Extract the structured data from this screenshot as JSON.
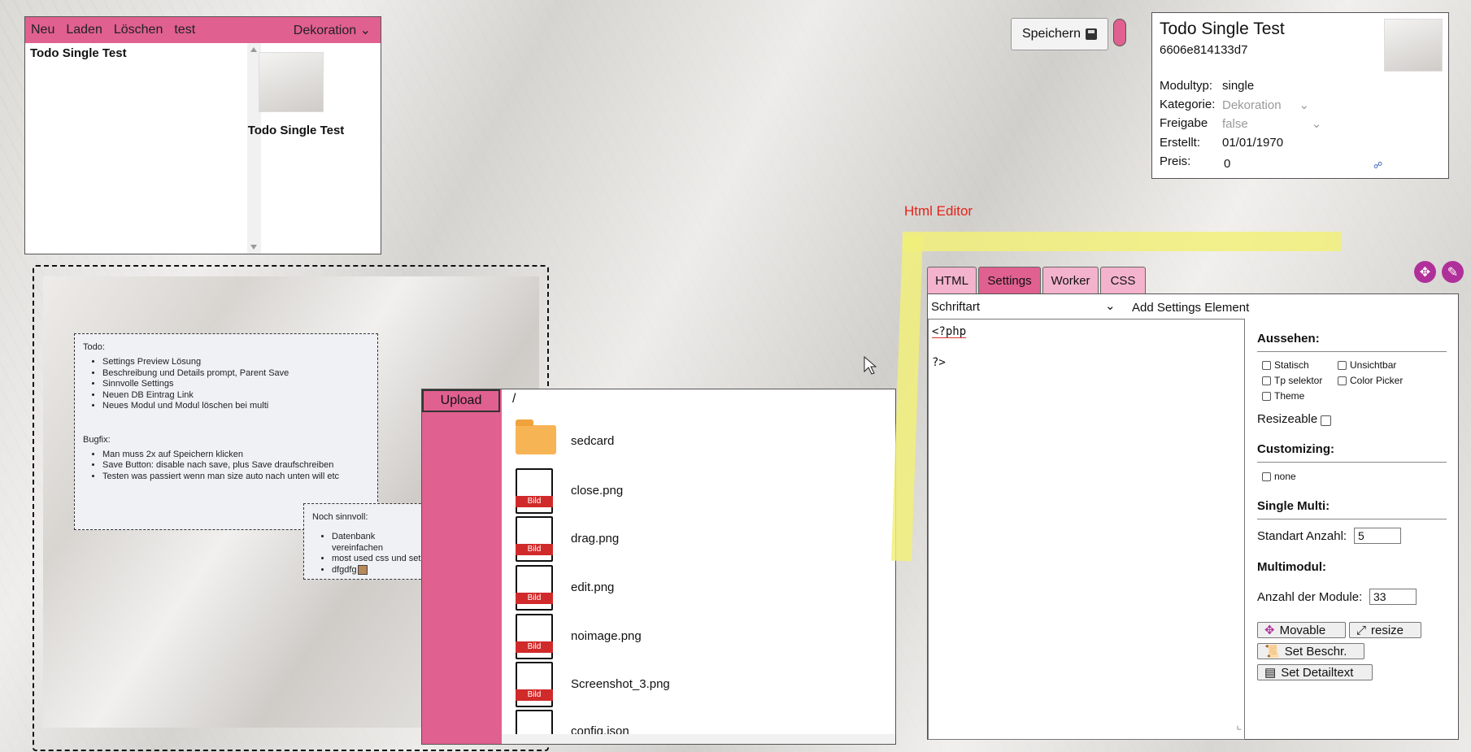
{
  "list_panel": {
    "menu": [
      "Neu",
      "Laden",
      "Löschen",
      "test"
    ],
    "category_dropdown": "Dekoration",
    "items": [
      "Todo Single Test"
    ],
    "thumb_label": "Todo Single Test"
  },
  "toolbar": {
    "save_label": "Speichern"
  },
  "details": {
    "title": "Todo Single Test",
    "id": "6606e814133d7",
    "rows": [
      {
        "label": "Modultyp:",
        "value": "single"
      },
      {
        "label": "Kategorie:",
        "value": "Dekoration"
      },
      {
        "label": "Freigabe",
        "value": "false"
      },
      {
        "label": "Erstellt:",
        "value": "01/01/1970"
      },
      {
        "label": "Preis:",
        "value": "0"
      }
    ]
  },
  "preview": {
    "note1": {
      "todo_title": "Todo:",
      "todo_items": [
        "Settings Preview Lösung",
        "Beschreibung und Details prompt, Parent Save",
        "Sinnvolle Settings",
        "Neuen DB Eintrag Link",
        "Neues Modul und Modul löschen bei multi"
      ],
      "bugfix_title": "Bugfix:",
      "bugfix_items": [
        "Man muss 2x auf Speichern klicken",
        "Save Button: disable nach save, plus Save draufschreiben",
        "Testen was passiert wenn man size auto nach unten will etc"
      ]
    },
    "note2": {
      "title": "Noch sinnvoll:",
      "items": [
        "Datenbank vereinfachen",
        "most used css und set",
        "dfgdfg"
      ]
    }
  },
  "editor": {
    "label": "Html Editor",
    "tabs": [
      "HTML",
      "Settings",
      "Worker",
      "CSS"
    ],
    "active_tab": "Settings",
    "font_select": "Schriftart",
    "add_settings": "Add Settings Element",
    "code_lines": [
      "<?php",
      "",
      "?>"
    ]
  },
  "settings": {
    "appearance_title": "Aussehen:",
    "appearance_options": [
      "Statisch",
      "Unsichtbar",
      "Tp selektor",
      "Color Picker",
      "Theme"
    ],
    "resizeable_label": "Resizeable",
    "customizing_title": "Customizing:",
    "customizing_options": [
      "none"
    ],
    "single_multi_title": "Single Multi:",
    "standart_label": "Standart Anzahl:",
    "standart_value": "5",
    "multimodul_title": "Multimodul:",
    "module_count_label": "Anzahl der Module:",
    "module_count_value": "33",
    "buttons": [
      "Movable",
      "resize",
      "Set Beschr.",
      "Set Detailtext"
    ]
  },
  "file_manager": {
    "upload_label": "Upload",
    "path": "/",
    "doc_badge": "Bild",
    "files": [
      {
        "name": "sedcard",
        "type": "folder"
      },
      {
        "name": "close.png",
        "type": "image"
      },
      {
        "name": "drag.png",
        "type": "image"
      },
      {
        "name": "edit.png",
        "type": "image"
      },
      {
        "name": "noimage.png",
        "type": "image"
      },
      {
        "name": "Screenshot_3.png",
        "type": "image"
      },
      {
        "name": "config.json",
        "type": "file"
      }
    ]
  }
}
